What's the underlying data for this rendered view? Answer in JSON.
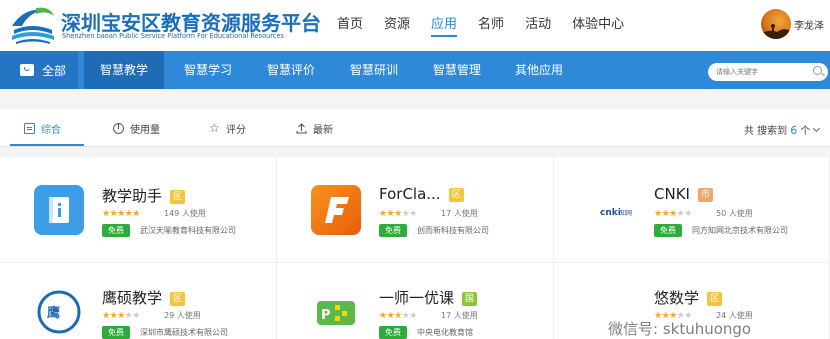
{
  "header": {
    "title": "深圳宝安区教育资源服务平台",
    "subtitle": "Shenzhen baoan Public Service Platform For Educational Resources",
    "nav": [
      "首页",
      "资源",
      "应用",
      "名师",
      "活动",
      "体验中心"
    ],
    "active_nav": "应用",
    "user_name": "李龙泽"
  },
  "category_bar": {
    "all_label": "全部",
    "items": [
      "智慧教学",
      "智慧学习",
      "智慧评价",
      "智慧研训",
      "智慧管理",
      "其他应用"
    ],
    "active": "智慧教学",
    "search_placeholder": "请输入关键字"
  },
  "sort_bar": {
    "items": [
      "综合",
      "使用量",
      "评分",
      "最新"
    ],
    "active": "综合",
    "result_prefix": "共 搜索到",
    "result_count": "6",
    "result_suffix": "个"
  },
  "apps": [
    {
      "name": "教学助手",
      "tag": "区",
      "tag_color": "#f2c53d",
      "rating": 5,
      "users": "149 人使用",
      "free": "免费",
      "company": "武汉天喻教育科技有限公司",
      "icon": "book-info-icon",
      "icon_color": "#3d9de6"
    },
    {
      "name": "ForCla...",
      "tag": "区",
      "tag_color": "#f2c53d",
      "rating": 3,
      "users": "17 人使用",
      "free": "免费",
      "company": "创而新科技有限公司",
      "icon": "forclass-f-icon",
      "icon_color": "#f07a14"
    },
    {
      "name": "CNKI",
      "tag": "市",
      "tag_color": "#f0a56b",
      "rating": 3,
      "users": "50 人使用",
      "free": "免费",
      "company": "同方知网北京技术有限公司",
      "icon": "cnki-logo-icon",
      "icon_color": "#ffffff"
    },
    {
      "name": "鹰硕教学",
      "tag": "区",
      "tag_color": "#f2c53d",
      "rating": 3,
      "users": "29 人使用",
      "free": "免费",
      "company": "深圳市鹰硕技术有限公司",
      "icon": "yingshuo-logo-icon",
      "icon_color": "#ffffff"
    },
    {
      "name": "一师一优课",
      "tag": "国",
      "tag_color": "#8cc63f",
      "rating": 3,
      "users": "17 人使用",
      "free": "免费",
      "company": "中央电化教育馆",
      "icon": "yishi-logo-icon",
      "icon_color": "#ffffff"
    },
    {
      "name": "悠数学",
      "tag": "区",
      "tag_color": "#f2c53d",
      "rating": 3,
      "users": "24 人使用",
      "free": "免费",
      "company": "",
      "icon": "youshuxue-icon",
      "icon_color": "#ffffff"
    }
  ],
  "watermark": "微信号: sktuhuongo"
}
